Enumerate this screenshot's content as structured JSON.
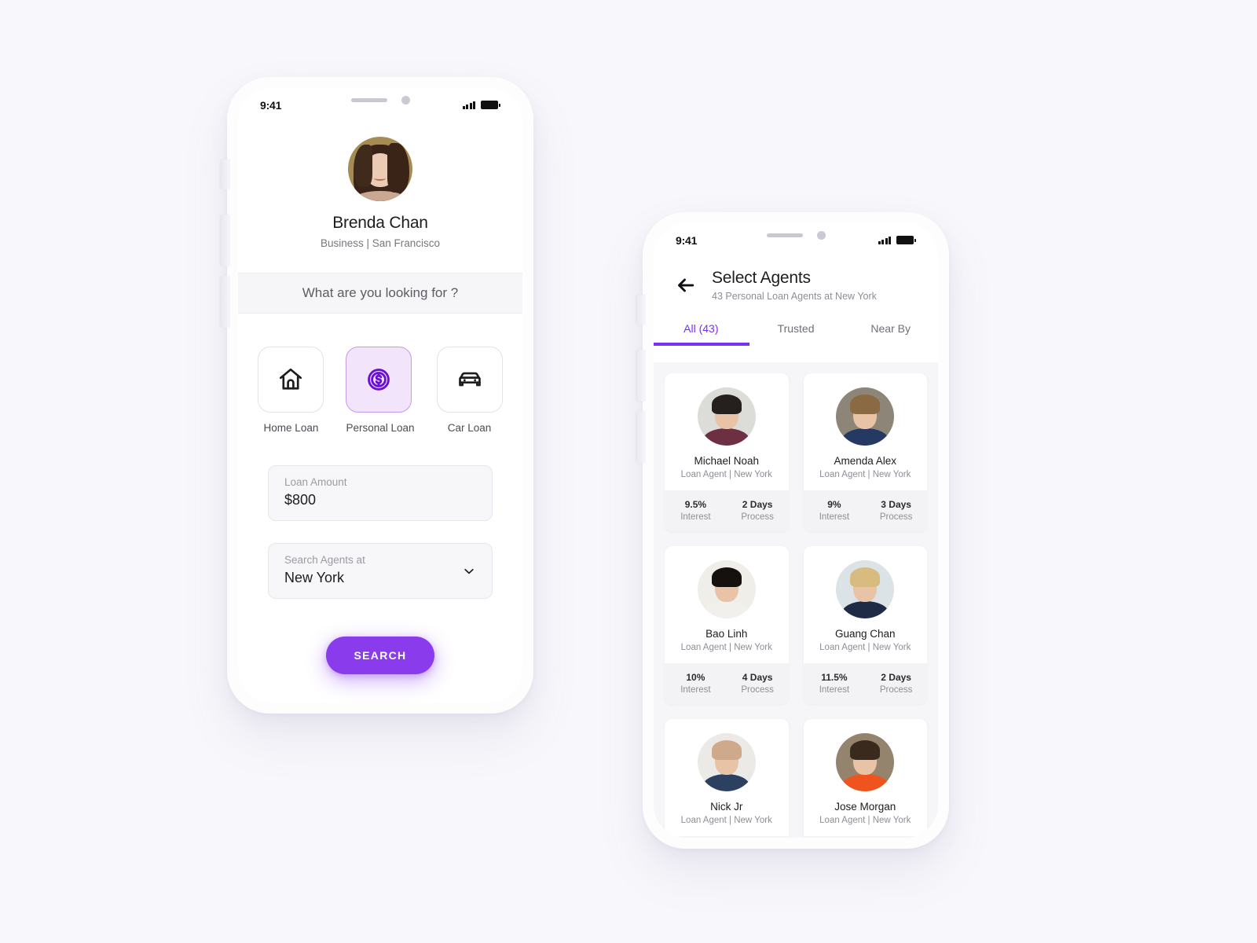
{
  "canvas": {
    "background": "#f8f7fb",
    "accent": "#7b2ff2"
  },
  "phone_one": {
    "status_bar": {
      "time": "9:41",
      "signal_icon": "cellular-signal-icon",
      "battery_icon": "battery-full-icon"
    },
    "profile": {
      "avatar_name": "user-avatar",
      "name": "Brenda Chan",
      "subtitle": "Business | San Francisco"
    },
    "search_prompt": "What are you looking for ?",
    "loan_types": [
      {
        "label": "Home Loan",
        "icon": "home-icon",
        "selected": false
      },
      {
        "label": "Personal Loan",
        "icon": "dollar-coin-icon",
        "selected": true
      },
      {
        "label": "Car Loan",
        "icon": "car-icon",
        "selected": false
      }
    ],
    "amount_field": {
      "label": "Loan Amount",
      "value": "$800"
    },
    "location_field": {
      "label": "Search Agents at",
      "value": "New York",
      "icon": "chevron-down-icon"
    },
    "search_button": "SEARCH"
  },
  "phone_two": {
    "status_bar": {
      "time": "9:41",
      "signal_icon": "cellular-signal-icon",
      "battery_icon": "battery-full-icon"
    },
    "header": {
      "back_icon": "back-arrow-icon",
      "title": "Select Agents",
      "subtitle": "43 Personal Loan Agents at New York"
    },
    "tabs": [
      {
        "label": "All (43)",
        "active": true
      },
      {
        "label": "Trusted",
        "active": false
      },
      {
        "label": "Near By",
        "active": false
      }
    ],
    "stat_keys": {
      "interest": "Interest",
      "process": "Process"
    },
    "agents": [
      {
        "name": "Michael Noah",
        "role": "Loan Agent | New York",
        "interest": "9.5%",
        "process": "2 Days",
        "photo": "agent-photo",
        "colors": {
          "bg": "#dcdcd8",
          "hair": "#25201d",
          "body": "#6d2f42"
        }
      },
      {
        "name": "Amenda Alex",
        "role": "Loan Agent | New York",
        "interest": "9%",
        "process": "3 Days",
        "photo": "agent-photo",
        "colors": {
          "bg": "#8d8578",
          "hair": "#8a6a43",
          "body": "#253a63"
        }
      },
      {
        "name": "Bao Linh",
        "role": "Loan Agent | New York",
        "interest": "10%",
        "process": "4 Days",
        "photo": "agent-photo",
        "colors": {
          "bg": "#efeee8",
          "hair": "#15110f",
          "body": "#f2f0ec"
        }
      },
      {
        "name": "Guang Chan",
        "role": "Loan Agent | New York",
        "interest": "11.5%",
        "process": "2 Days",
        "photo": "agent-photo",
        "colors": {
          "bg": "#dbe3e6",
          "hair": "#d8bb7e",
          "body": "#1f2a45"
        }
      },
      {
        "name": "Nick Jr",
        "role": "Loan Agent | New York",
        "interest": "",
        "process": "",
        "photo": "agent-photo",
        "colors": {
          "bg": "#eceae7",
          "hair": "#cfa98c",
          "body": "#2c4160"
        }
      },
      {
        "name": "Jose Morgan",
        "role": "Loan Agent | New York",
        "interest": "",
        "process": "",
        "photo": "agent-photo",
        "colors": {
          "bg": "#94836d",
          "hair": "#3a2a1e",
          "body": "#f0541e"
        }
      }
    ]
  }
}
